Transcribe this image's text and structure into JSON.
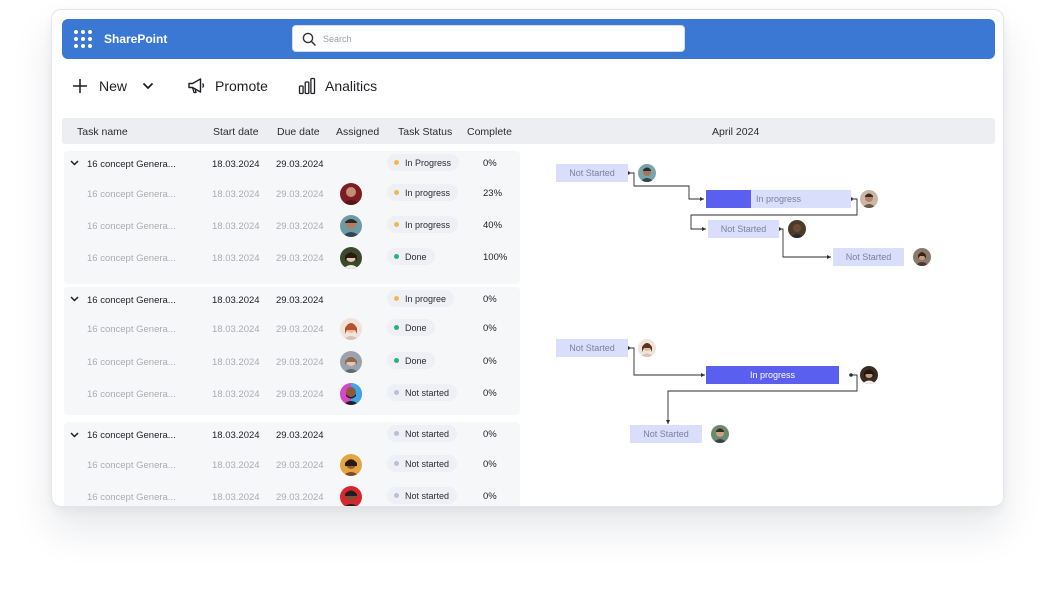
{
  "app": {
    "name": "SharePoint"
  },
  "search": {
    "placeholder": "Search",
    "value": ""
  },
  "toolbar": {
    "new_label": "New",
    "promote_label": "Promote",
    "analytics_label": "Analitics"
  },
  "table": {
    "columns": [
      "Task name",
      "Start date",
      "Due date",
      "Assigned",
      "Task Status",
      "Complete"
    ],
    "month": "April 2024"
  },
  "groups": [
    {
      "parent": {
        "name": "16 concept Genera...",
        "start": "18.03.2024",
        "due": "29.03.2024",
        "status": "In Progress",
        "complete": "0%"
      },
      "children": [
        {
          "name": "16 concept Genera...",
          "start": "18.03.2024",
          "due": "29.03.2024",
          "status": "In progress",
          "complete": "23%"
        },
        {
          "name": "16 concept Genera...",
          "start": "18.03.2024",
          "due": "29.03.2024",
          "status": "In progress",
          "complete": "40%"
        },
        {
          "name": "16 concept Genera...",
          "start": "18.03.2024",
          "due": "29.03.2024",
          "status": "Done",
          "complete": "100%"
        }
      ]
    },
    {
      "parent": {
        "name": "16 concept Genera...",
        "start": "18.03.2024",
        "due": "29.03.2024",
        "status": "In progree",
        "complete": "0%"
      },
      "children": [
        {
          "name": "16 concept Genera...",
          "start": "18.03.2024",
          "due": "29.03.2024",
          "status": "Done",
          "complete": "0%"
        },
        {
          "name": "16 concept Genera...",
          "start": "18.03.2024",
          "due": "29.03.2024",
          "status": "Done",
          "complete": "0%"
        },
        {
          "name": "16 concept Genera...",
          "start": "18.03.2024",
          "due": "29.03.2024",
          "status": "Not started",
          "complete": "0%"
        }
      ]
    },
    {
      "parent": {
        "name": "16 concept Genera...",
        "start": "18.03.2024",
        "due": "29.03.2024",
        "status": "Not started",
        "complete": "0%"
      },
      "children": [
        {
          "name": "16 concept Genera...",
          "start": "18.03.2024",
          "due": "29.03.2024",
          "status": "Not started",
          "complete": "0%"
        },
        {
          "name": "16 concept Genera...",
          "start": "18.03.2024",
          "due": "29.03.2024",
          "status": "Not started",
          "complete": "0%"
        }
      ]
    }
  ],
  "gantt": {
    "bars": [
      {
        "label": "Not Started",
        "status": "not-started"
      },
      {
        "label": "In progress",
        "status": "in-progress"
      },
      {
        "label": "Not Started",
        "status": "not-started"
      },
      {
        "label": "Not Started",
        "status": "not-started"
      },
      {
        "label": "Not Started",
        "status": "not-started"
      },
      {
        "label": "In progress",
        "status": "in-progress"
      },
      {
        "label": "Not Started",
        "status": "not-started"
      }
    ]
  },
  "colors": {
    "brand": "#3a78d4",
    "bar_progress": "#5b5fef",
    "bar_light": "#d9defb",
    "status_in_progress": "#f2b94a",
    "status_done": "#27b37a",
    "status_not_started": "#b9bfd6"
  }
}
